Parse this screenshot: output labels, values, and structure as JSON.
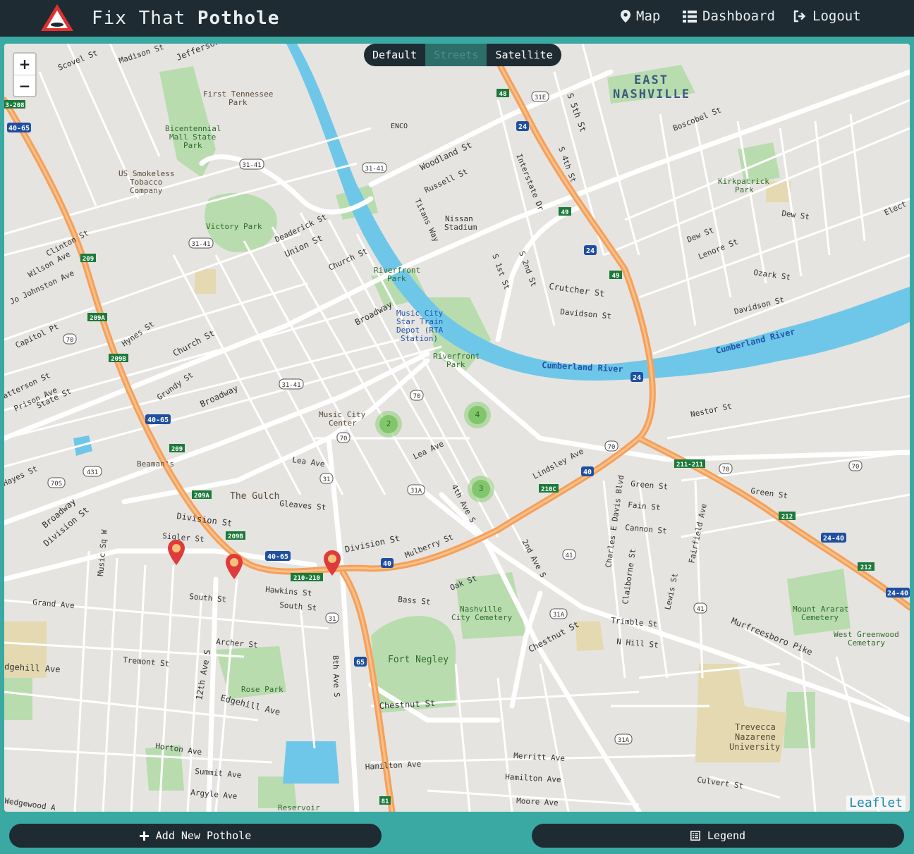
{
  "app": {
    "title_prefix": "Fix That",
    "title_bold": "Pothole"
  },
  "nav": {
    "map": "Map",
    "dashboard": "Dashboard",
    "logout": "Logout"
  },
  "layers": {
    "default": "Default",
    "streets": "Streets",
    "satellite": "Satellite",
    "active": "Streets"
  },
  "zoom": {
    "in": "+",
    "out": "−"
  },
  "attribution": "Leaflet",
  "clusters": [
    {
      "count": "2"
    },
    {
      "count": "4"
    },
    {
      "count": "3"
    }
  ],
  "actions": {
    "add": "Add New Pothole",
    "legend": "Legend"
  },
  "colors": {
    "navbar": "#1f2b33",
    "background": "#3aa9a4",
    "river": "#6ec7e8",
    "highway": "#f5a05a",
    "park": "#b8dcae",
    "marker": "#e03b3b"
  },
  "map_labels": {
    "east_nashville": "EAST\nNASHVILLE",
    "woodland_st": "Woodland St",
    "russell_st": "Russell St",
    "titans_way": "Titans Way",
    "nissan_stadium": "Nissan\nStadium",
    "enco": "ENCO",
    "first_tennessee_park": "First Tennessee\nPark",
    "bicentennial_park": "Bicentennial\nMall State\nPark",
    "us_smokeless": "US Smokeless\nTobacco\nCompany",
    "victory_park": "Victory Park",
    "deaderick_st": "Deaderick St",
    "union_st": "Union St",
    "church_st": "Church St",
    "riverfront_park_1": "Riverfront\nPark",
    "music_city_star": "Music City\nStar Train\nDepot (RTA\nStation)",
    "riverfront_park_2": "Riverfront\nPark",
    "broadway_1": "Broadway",
    "broadway_2": "Broadway",
    "broadway_3": "Broadway",
    "cumberland_river_1": "Cumberland River",
    "cumberland_river_2": "Cumberland River",
    "crutcher_st": "Crutcher St",
    "davidson_st_1": "Davidson St",
    "davidson_st_2": "Davidson St",
    "ozark_st": "Ozark St",
    "lenore_st": "Lenore St",
    "dew_st_1": "Dew St",
    "dew_st_2": "Dew St",
    "kirkpatrick_park": "Kirkpatrick\nPark",
    "boscobel_st": "Boscobel St",
    "nestor_st": "Nestor St",
    "music_city_center": "Music City\nCenter",
    "lea_ave_1": "Lea Ave",
    "lea_ave_2": "Lea Ave",
    "lindsley_ave": "Lindsley Ave",
    "green_st_1": "Green St",
    "green_st_2": "Green St",
    "fain_st": "Fain St",
    "cannon_st": "Cannon St",
    "charles_davis": "Charles E Davis Blvd",
    "fairfield_ave": "Fairfield Ave",
    "the_gulch": "The Gulch",
    "gleaves_st": "Gleaves St",
    "division_st_1": "Division St",
    "division_st_2": "Division St",
    "division_st_3": "Division St",
    "mulberry_st": "Mulberry St",
    "beamans": "Beaman's",
    "sigler_st": "Sigler St",
    "hawkins_st": "Hawkins St",
    "south_st_1": "South St",
    "south_st_2": "South St",
    "bass_st": "Bass St",
    "oak_st": "Oak St",
    "nashville_cemetery": "Nashville\nCity Cemetery",
    "fort_negley": "Fort Negley",
    "chestnut_st_1": "Chestnut St",
    "chestnut_st_2": "Chestnut St",
    "trimble_st": "Trimble St",
    "n_hill_st": "N Hill St",
    "murfreesboro_pike": "Murfreesboro Pike",
    "mount_ararat": "Mount Ararat\nCemetery",
    "west_greenwood": "West Greenwood\nCemetary",
    "trevecca": "Trevecca\nNazarene\nUniversity",
    "culvert_st": "Culvert St",
    "merritt_ave": "Merritt Ave",
    "hamilton_ave_1": "Hamilton Ave",
    "hamilton_ave_2": "Hamilton Ave",
    "moore_ave": "Moore Ave",
    "grand_ave": "Grand Ave",
    "archer_st": "Archer St",
    "tremont_st": "Tremont St",
    "rose_park": "Rose Park",
    "edgehill_ave_1": "Edgehill Ave",
    "edgehill_ave_2": "Edgehill Ave",
    "horton_ave": "Horton Ave",
    "summit_ave": "Summit Ave",
    "argyle_ave": "Argyle Ave",
    "reservoir": "Reservoir",
    "wedgewood": "Wedgewood A",
    "capitol_pt": "Capitol Pt",
    "hynes_st": "Hynes St",
    "church_st_2": "Church St",
    "grundy_st": "Grundy St",
    "clinton_st": "Clinton St",
    "wilson_ave": "Wilson Ave",
    "jo_johnston": "Jo Johnston Ave",
    "madison_st": "Madison St",
    "jefferson": "Jefferson",
    "scovel_st": "Scovel St",
    "hayes_st": "Hayes St",
    "prison_ave": "Prison Ave",
    "state_st": "State St",
    "patterson_st": "Patterson St",
    "interstate_dr": "Interstate Dr",
    "s_5th_st": "S 5th St",
    "s_4th_st": "S 4th St",
    "s_1st_st": "S 1st St",
    "s_2nd_st": "S 2nd St",
    "8th_ave_s": "8th Ave S",
    "12th_ave_s": "12th Ave S",
    "4th_ave_s": "4th Ave S",
    "2nd_ave_s": "2nd Ave S",
    "music_sq": "Music Sq W",
    "lewis_st": "Lewis St",
    "claiborne_st": "Claiborne St",
    "elect": "Elect"
  },
  "shields": {
    "i40_65_a": "40-65",
    "i40_65_b": "40-65",
    "i40_65_c": "40-65",
    "i24_a": "24",
    "i24_b": "24",
    "i24_c": "24",
    "i40_a": "40",
    "i40_b": "40",
    "i65": "65",
    "i24_40_a": "24-40",
    "i24_40_b": "24-40",
    "r48": "48",
    "r49_a": "49",
    "r49_b": "49",
    "r209": "209",
    "r209a": "209A",
    "r209b": "209B",
    "r209_2": "209",
    "r209a_2": "209A",
    "r209b_2": "209B",
    "r210_210": "210-210",
    "r210c": "210C",
    "r211_211": "211-211",
    "r212_a": "212",
    "r212_b": "212",
    "r81": "81",
    "us31_41_a": "31-41",
    "us31_41_b": "31-41",
    "us31_41_c": "31-41",
    "us31_41_d": "31-41",
    "us31e": "31E",
    "us70_a": "70",
    "us70_b": "70",
    "us70_c": "70",
    "us70_d": "70",
    "us70_e": "70",
    "us70_f": "70",
    "us70s": "70S",
    "us431": "431",
    "us31_a": "31",
    "us31_b": "31",
    "us31a_a": "31A",
    "us31a_b": "31A",
    "us31a_c": "31A",
    "us41_a": "41",
    "us41_b": "41",
    "r3208": "3-208"
  }
}
